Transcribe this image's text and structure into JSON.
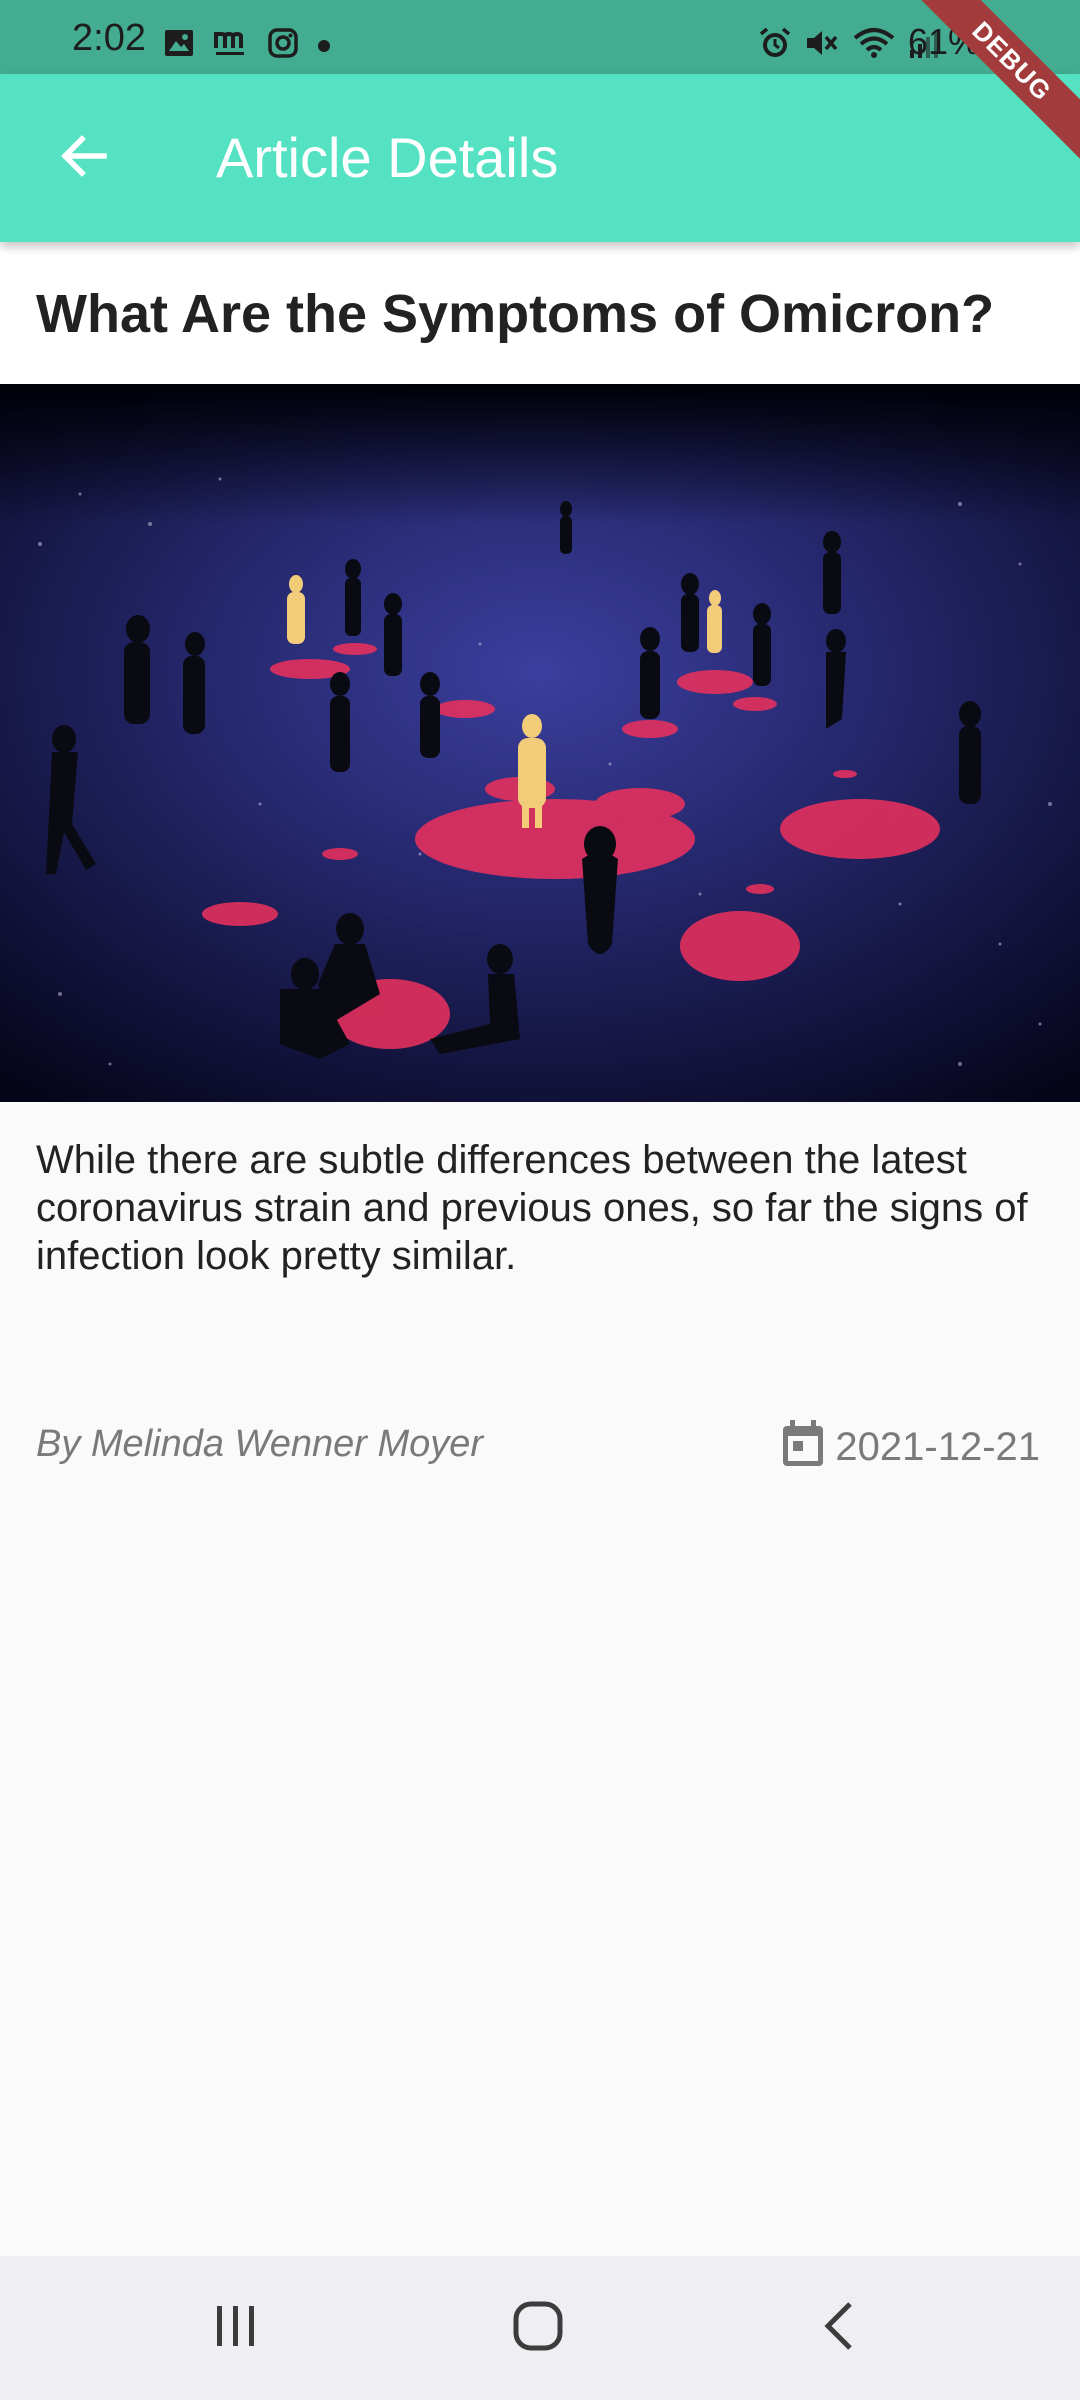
{
  "status_bar": {
    "time": "2:02",
    "battery": "61%",
    "left_icons": [
      "gallery-icon",
      "m-app-icon",
      "instagram-icon",
      "dot-icon"
    ],
    "right_icons": [
      "alarm-icon",
      "mute-icon",
      "wifi-icon",
      "signal-icon"
    ]
  },
  "debug_banner": "DEBUG",
  "app_bar": {
    "title": "Article Details",
    "back_icon": "arrow-back-icon",
    "color": "#55e2c3"
  },
  "article": {
    "title": "What Are the Symptoms of Omicron?",
    "image_alt": "Illustration of people standing on a dark blue floor with glowing red infection spots",
    "description": "While there are subtle differences between the latest coronavirus strain and previous ones, so far the signs of infection look pretty similar.",
    "author": "By Melinda Wenner Moyer",
    "date": "2021-12-21",
    "date_icon": "calendar-icon"
  },
  "nav_bar": {
    "buttons": [
      "recent-apps-icon",
      "home-icon",
      "back-icon"
    ]
  }
}
